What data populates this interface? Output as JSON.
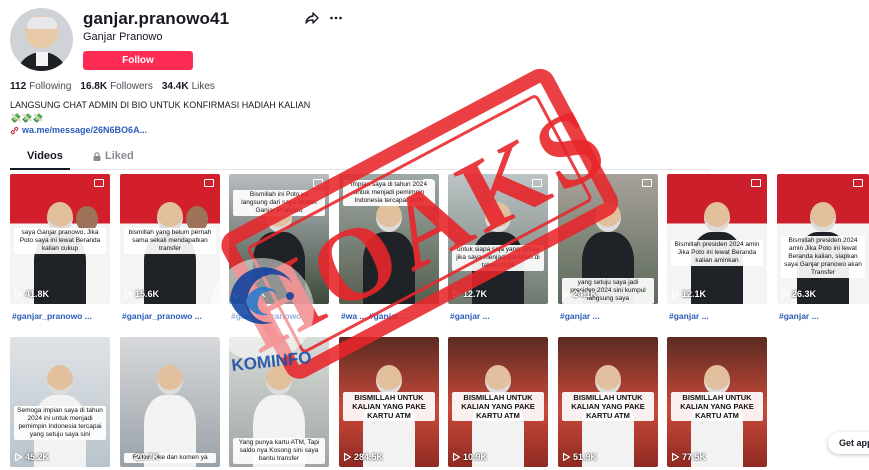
{
  "profile": {
    "username": "ganjar.pranowo41",
    "nickname": "Ganjar Pranowo",
    "follow_label": "Follow",
    "following_count": "112",
    "following_label": "Following",
    "followers_count": "16.8K",
    "followers_label": "Followers",
    "likes_count": "34.4K",
    "likes_label": "Likes",
    "bio_line1": "LANGSUNG CHAT ADMIN DI BIO UNTUK KONFIRMASI HADIAH KALIAN",
    "bio_line2": "💸💸💸",
    "link": "wa.me/message/26N6BO6A..."
  },
  "tabs": {
    "videos": "Videos",
    "liked": "Liked"
  },
  "videos": [
    {
      "views": "41.8K",
      "hashtag": "#ganjar_pranowo ...",
      "caption": "saya Ganjar pranowo, Jika Poto saya ini lewat Beranda kalian cukup"
    },
    {
      "views": "15.6K",
      "hashtag": "#ganjar_pranowo ...",
      "caption": "bismillah yang belum pernah sama sekali mendapatkan transfer"
    },
    {
      "views": "157K",
      "hashtag": "#ganjar_pranowo ...",
      "caption": "Bismillah ini Poto ya langsung dari saya sendiri Ganjar Pranowo"
    },
    {
      "views": "",
      "hashtag": "#wa ... #ganjar ...",
      "caption": "impian saya di tahun 2024 untuk menjadi pemimpin Indonesia tercapai amin"
    },
    {
      "views": "12.7K",
      "hashtag": "#ganjar ...",
      "caption": "untuk siapa saja yang setuju jika saya menjadi presiden di tahun 2024"
    },
    {
      "views": "24.1K",
      "hashtag": "#ganjar ...",
      "caption": "yang setuju saya jadi presiden 2024 sini kumpul langsung saya"
    },
    {
      "views": "12.1K",
      "hashtag": "#ganjar ...",
      "caption": "Bismillah presiden 2024 amin Jika Poto ini lewat Beranda kalian aminkan"
    },
    {
      "views": "26.3K",
      "hashtag": "#ganjar ...",
      "caption": "Bismillah presiden 2024 amin Jika Poto ini lewat Beranda kalian, siapkan saya Ganjar pranowo akan Transfer"
    },
    {
      "views": "45.2K",
      "hashtag": "",
      "caption": "Semoga impian saya di tahun 2024 ini untuk menjadi pemimpin Indonesia tercapai yang setuju saya sini"
    },
    {
      "views": "20.7K",
      "hashtag": "",
      "caption": "Follow Like dan komen ya"
    },
    {
      "views": "",
      "hashtag": "",
      "caption": "Yang punya kartu ATM, Tapi saldo nya Kosong sini saya bantu transfer"
    },
    {
      "views": "284.5K",
      "hashtag": "",
      "caption": "BISMILLAH UNTUK KALIAN YANG PAKE KARTU ATM"
    },
    {
      "views": "10.9K",
      "hashtag": "",
      "caption": "BISMILLAH UNTUK KALIAN YANG PAKE KARTU ATM"
    },
    {
      "views": "51.9K",
      "hashtag": "",
      "caption": "BISMILLAH UNTUK KALIAN YANG PAKE KARTU ATM"
    },
    {
      "views": "77.5K",
      "hashtag": "",
      "caption": "BISMILLAH UNTUK KALIAN YANG PAKE KARTU ATM"
    }
  ],
  "overlay": {
    "stamp_text": "HOAKS",
    "logo_text": "KOMINFO"
  },
  "get_app_label": "Get app",
  "colors": {
    "brand": "#fe2c55",
    "stamp": "#e8262b",
    "link": "#2b5db9"
  }
}
